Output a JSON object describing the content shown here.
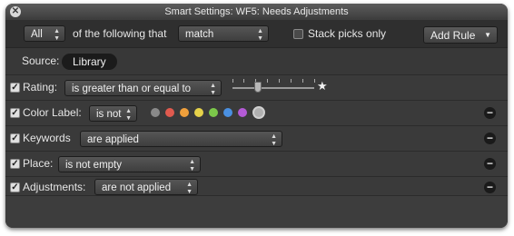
{
  "window": {
    "title": "Smart Settings: WF5: Needs Adjustments"
  },
  "toolbar": {
    "match_scope": "All",
    "of_following_label": "of the following that",
    "match_mode": "match",
    "stack_picks_label": "Stack picks only",
    "stack_picks_checked": false,
    "add_rule_label": "Add Rule"
  },
  "source": {
    "label": "Source:",
    "value": "Library"
  },
  "rules": {
    "rating": {
      "label": "Rating:",
      "operator": "is greater than or equal to",
      "checked": true,
      "value_stars": 1,
      "star_icon": "star-icon"
    },
    "color_label": {
      "label": "Color Label:",
      "operator": "is not",
      "checked": true,
      "swatches": [
        "#8a8a8a",
        "#e05a4e",
        "#f0a03c",
        "#e6d24a",
        "#7cc84a",
        "#4a90e2",
        "#b45ad6",
        "#b0b0b0"
      ]
    },
    "keywords": {
      "label": "Keywords",
      "operator": "are applied",
      "checked": true
    },
    "place": {
      "label": "Place:",
      "operator": "is not empty",
      "checked": true
    },
    "adjustments": {
      "label": "Adjustments:",
      "operator": "are not applied",
      "checked": true
    }
  },
  "icons": {
    "close": "close-icon",
    "remove": "minus-circle-icon",
    "check": "checkmark-icon"
  }
}
